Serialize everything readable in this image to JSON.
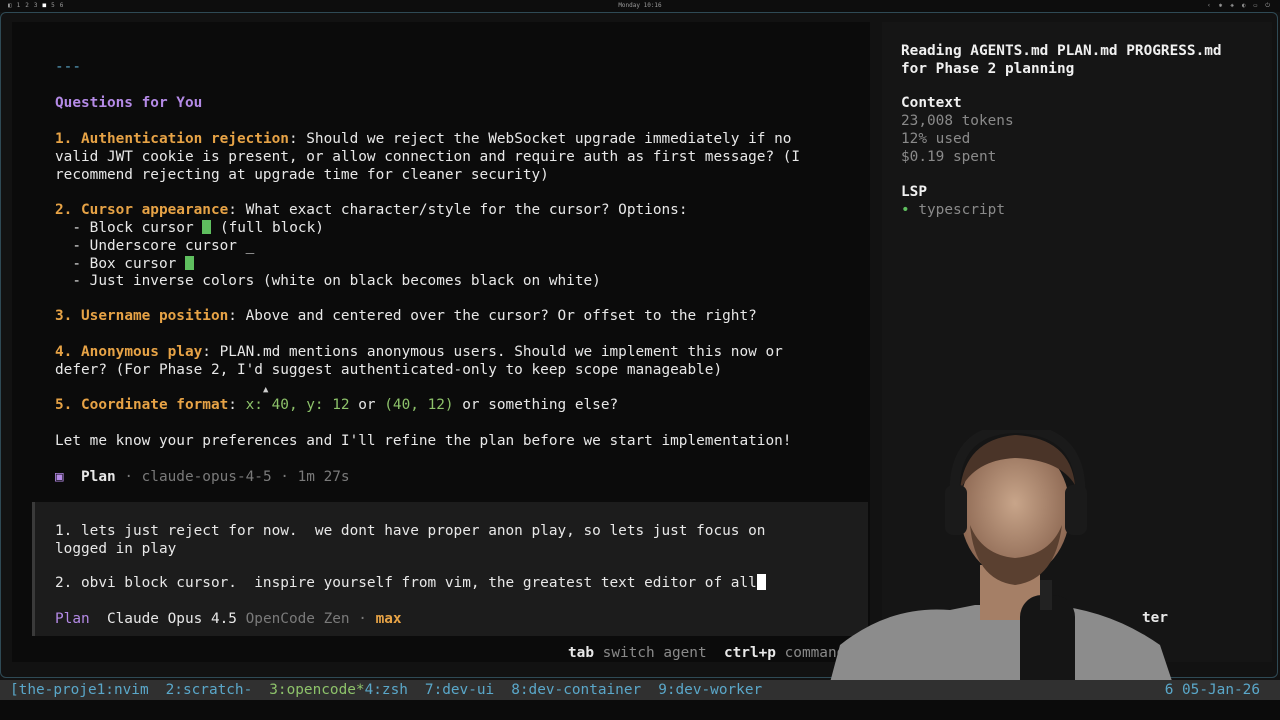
{
  "topbar": {
    "workspaces": [
      "1",
      "2",
      "3",
      "4",
      "5",
      "6"
    ],
    "clock": "Monday 10:16"
  },
  "main": {
    "hr": "---",
    "heading": "Questions for You",
    "q1": {
      "num": "1.",
      "key": "Authentication rejection",
      "text1": ": Should we reject the WebSocket upgrade immediately if no",
      "text2": "valid JWT cookie is present, or allow connection and require auth as first message? (I",
      "text3": "recommend rejecting at upgrade time for cleaner security)"
    },
    "q2": {
      "num": "2.",
      "key": "Cursor appearance",
      "text": ": What exact character/style for the cursor? Options:",
      "opt1a": "  - Block cursor ",
      "opt1b": " (full block)",
      "opt2": "  - Underscore cursor _",
      "opt3": "  - Box cursor ",
      "opt4": "  - Just inverse colors (white on black becomes black on white)"
    },
    "q3": {
      "num": "3.",
      "key": "Username position",
      "text": ": Above and centered over the cursor? Or offset to the right?"
    },
    "q4": {
      "num": "4.",
      "key": "Anonymous play",
      "text1": ": PLAN.md mentions anonymous users. Should we implement this now or",
      "text2": "defer? (For Phase 2, I'd suggest authenticated-only to keep scope manageable)"
    },
    "q5": {
      "num": "5.",
      "key": "Coordinate format",
      "sep": ": ",
      "code1": "x: 40, y: 12",
      "or1": " or ",
      "code2": "(40, 12)",
      "rest": " or something else?"
    },
    "closing": "Let me know your preferences and I'll refine the plan before we start implementation!",
    "plan_line": {
      "icon": "▣",
      "mode": "Plan",
      "meta": " · claude-opus-4-5 · 1m 27s"
    }
  },
  "input": {
    "line1": "1. lets just reject for now.  we dont have proper anon play, so lets just focus on",
    "line2": "logged in play",
    "line3": "2. obvi block cursor.  inspire yourself from vim, the greatest text editor of all",
    "status": {
      "mode": "Plan",
      "model": "Claude Opus 4.5",
      "provider": "OpenCode Zen",
      "sep": " · ",
      "variant": "max"
    }
  },
  "hints": {
    "tab_key": "tab",
    "tab_desc": "switch agent",
    "cmd_key": "ctrl+p",
    "cmd_desc": "commands"
  },
  "sidebar": {
    "title": "Reading AGENTS.md PLAN.md PROGRESS.md for Phase 2 planning",
    "context_label": "Context",
    "tokens": "23,008 tokens",
    "used": "12% used",
    "spent": "$0.19 spent",
    "lsp_label": "LSP",
    "lsp_item": "typescript",
    "partial_text": "ter"
  },
  "tmux": {
    "windows": [
      "[the-proje1:nvim",
      "2:scratch-",
      "3:opencode*",
      "4:zsh",
      "7:dev-ui",
      "8:dev-container",
      "9:dev-worker"
    ],
    "right": "6 05-Jan-26"
  },
  "colors": {
    "accent_purple": "#b48ae6",
    "accent_orange": "#e7a346",
    "accent_green": "#8dc26a",
    "accent_blue": "#5aa7c9"
  }
}
